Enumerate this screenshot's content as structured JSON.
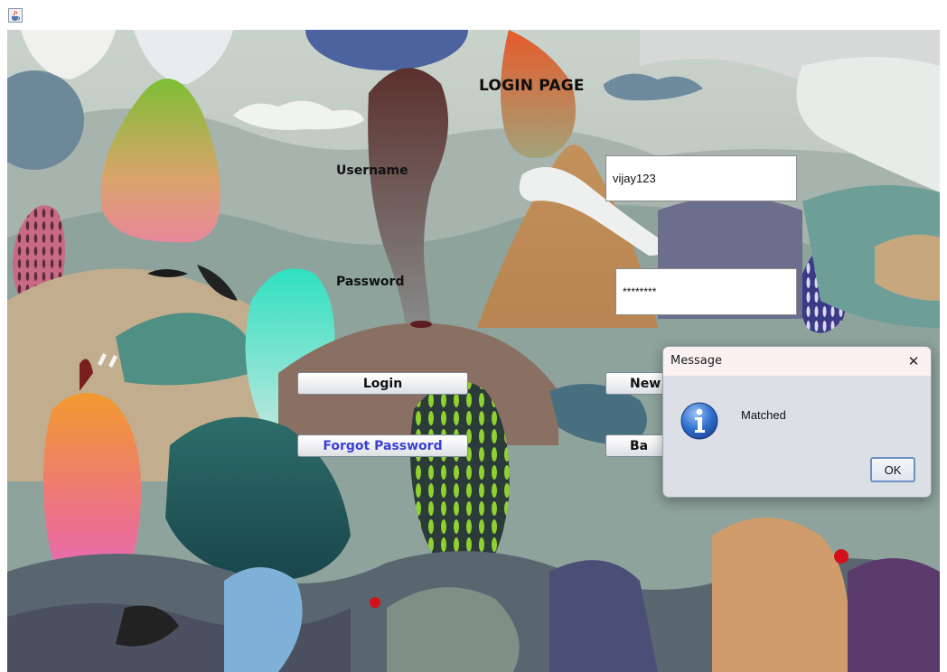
{
  "window": {
    "icon": "java-cup-icon"
  },
  "page": {
    "title": "LOGIN PAGE",
    "username_label": "Username",
    "password_label": "Password",
    "username_value": "vijay123",
    "password_value": "********"
  },
  "buttons": {
    "login": "Login",
    "new_user": "New",
    "forgot_password": "Forgot Password",
    "back": "Ba"
  },
  "dialog": {
    "title": "Message",
    "close": "✕",
    "icon": "info-icon",
    "message": "Matched",
    "ok": "OK"
  },
  "colors": {
    "accent_blue": "#3b3fd6",
    "dialog_bg": "#dcdfe6",
    "dialog_title_bg": "#fbf1f2"
  }
}
